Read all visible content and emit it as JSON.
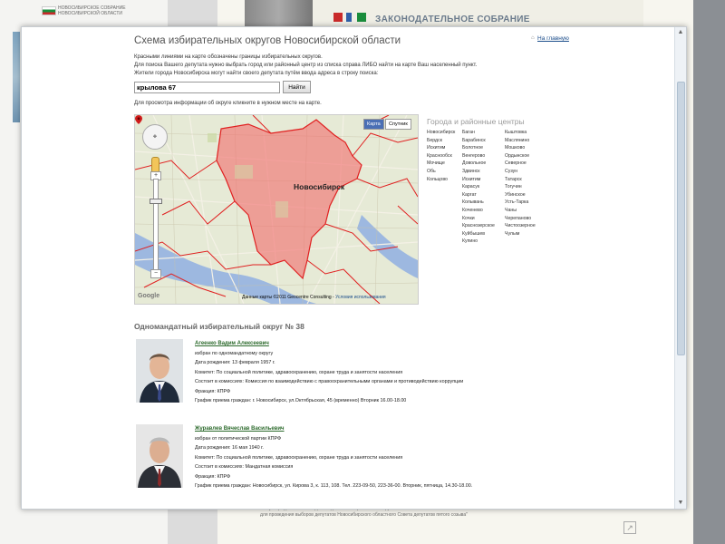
{
  "background": {
    "left_logo_text": "НОВОСИБИРСКОЕ СОБРАНИЕ НОВОСИБИРСКОЙ ОБЛАСТИ",
    "banner_title": "ЗАКОНОДАТЕЛЬНОЕ СОБРАНИЕ",
    "bottom_text_1": "\"Об утверждении схемы одномандатных избирательных округов",
    "bottom_text_2": "для проведения выборов депутатов Новосибирского областного Совета депутатов пятого созыва\"",
    "colors": {
      "accent_green": "#1a8d3c",
      "accent_red": "#c92a2a",
      "accent_blue": "#2f5fa8"
    }
  },
  "page": {
    "title": "Схема избирательных округов Новосибирской области",
    "home_link": "На главную",
    "intro_1": "Красными линиями на карте обозначены границы избирательных округов.",
    "intro_2": "Для поиска Вашего депутата нужно выбрать город или районный центр из списка справа ЛИБО найти на карте Ваш населенный пункт.",
    "intro_3": "Жители города Новосибирска могут найти своего депутата путём ввода адреса в строку поиска:",
    "search_value": "крылова 67",
    "search_button": "Найти",
    "map_hint": "Для просмотра информации об округе кликните в нужном месте на карте."
  },
  "map": {
    "type_active": "Карта",
    "type_inactive": "Спутник",
    "city_label": "Новосибирск",
    "google": "Google",
    "copyright": "Данные карты ©2011 Geocentre Consulting -",
    "copyright_link": "Условия использования",
    "district_color": "#f26b6b"
  },
  "cities": {
    "title": "Города и районные центры",
    "col1": [
      "Новосибирск",
      "Бердск",
      "Искитим",
      "Краснообск",
      "Мочище",
      "Обь",
      "Кольцово"
    ],
    "col2": [
      "Баган",
      "Барабинск",
      "Болотное",
      "Венгерово",
      "Довольное",
      "Здвинск",
      "Искитим",
      "Карасук",
      "Каргат",
      "Колывань",
      "Коченево",
      "Кочки",
      "Краснозерское",
      "Куйбышев",
      "Купино"
    ],
    "col3": [
      "Кыштовка",
      "Маслянино",
      "Мошково",
      "Ордынское",
      "Северное",
      "Сузун",
      "Татарск",
      "Тогучин",
      "Убинское",
      "Усть-Тарка",
      "Чаны",
      "Черепаново",
      "Чистоозерное",
      "Чулым"
    ]
  },
  "district": {
    "title": "Одномандатный избирательный округ № 38",
    "deputies": [
      {
        "name": "Агеенко Вадим Алексеевич",
        "elected": "избран по одномандатному округу",
        "birth": "Дата рождения: 13 февраля 1957 г.",
        "committee": "Комитет: По социальной политике, здравоохранению, охране труда и занятости населения",
        "commission": "Состоит в комиссиях: Комиссия по взаимодействию с правоохранительными органами и противодействию коррупции",
        "faction": "Фракция: КПРФ",
        "schedule": "График приема граждан: г. Новосибирск, ул.Октябрьская, 45 (временно) Вторник 16.00-18.00"
      },
      {
        "name": "Журавлев Вячеслав Васильевич",
        "elected": "избран от политической партии КПРФ",
        "birth": "Дата рождения: 16 мая 1940 г.",
        "committee": "Комитет: По социальной политике, здравоохранению, охране труда и занятости населения",
        "commission": "Состоит в комиссиях: Мандатная комиссия",
        "faction": "Фракция: КПРФ",
        "schedule": "График приема граждан: Новосибирск, ул. Кирова 3, к. 113, 108. Тел. 223-09-50, 223-36-00. Вторник, пятница, 14.30-18.00."
      }
    ]
  }
}
